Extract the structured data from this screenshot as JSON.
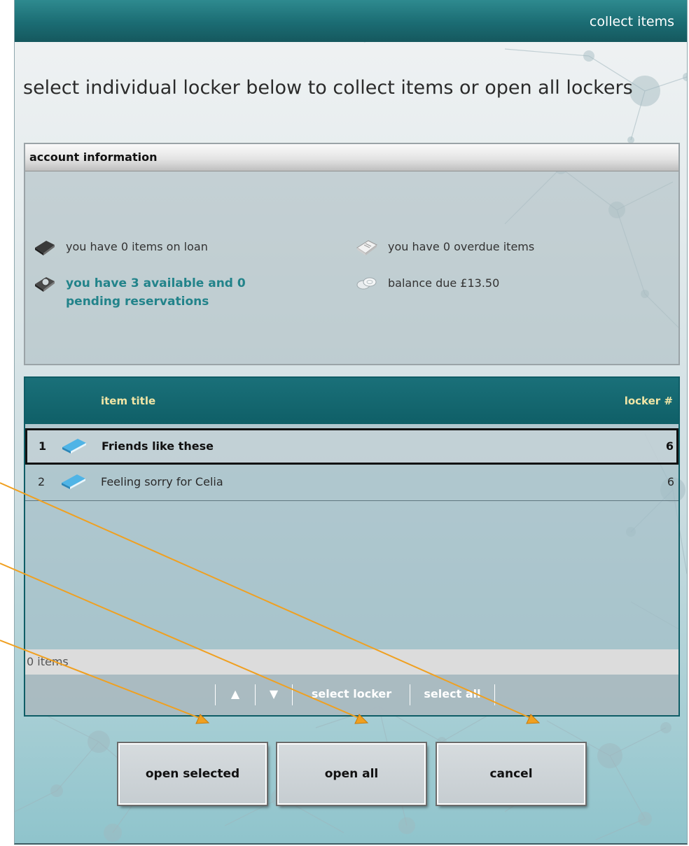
{
  "window": {
    "title": "collect items"
  },
  "instruction": "select individual locker below to collect items or open all lockers",
  "account": {
    "header": "account information",
    "loans": "you have 0 items on loan",
    "overdue": "you have 0 overdue items",
    "reservations": "you have 3 available and 0 pending reservations",
    "balance": "balance due £13.50"
  },
  "items_table": {
    "columns": {
      "title": "item title",
      "locker": "locker #"
    },
    "rows": [
      {
        "num": "1",
        "title": "Friends like these",
        "locker": "6"
      },
      {
        "num": "2",
        "title": "Feeling sorry for Celia",
        "locker": "6"
      }
    ],
    "status": "0 items"
  },
  "toolbar": {
    "up_glyph": "▲",
    "down_glyph": "▼",
    "select_locker": "select locker",
    "select_all": "select all"
  },
  "actions": {
    "open_selected": "open selected",
    "open_all": "open all",
    "cancel": "cancel"
  },
  "colors": {
    "title_bar": "#1b6c73",
    "accent_text": "#22838a",
    "header_text": "#f0e6a6",
    "annotation_arrow": "#f0a020"
  },
  "icons": {
    "loans": "dark-book-icon",
    "reservations": "reservation-book-icon",
    "overdue": "overdue-book-icon",
    "balance": "coins-icon",
    "item": "blue-book-icon"
  }
}
